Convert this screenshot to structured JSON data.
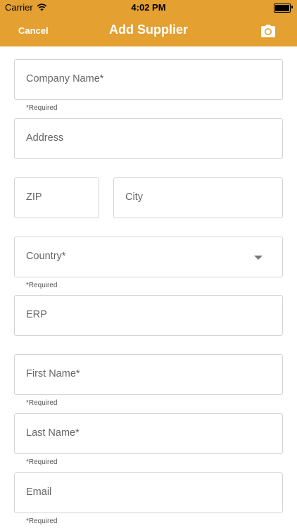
{
  "status": {
    "carrier": "Carrier",
    "time": "4:02 PM"
  },
  "nav": {
    "cancel_label": "Cancel",
    "title": "Add Supplier",
    "camera_icon": "camera-icon"
  },
  "colors": {
    "accent": "#e4a030",
    "field_border": "#d4d4d4",
    "placeholder": "#666666"
  },
  "form": {
    "company_name": {
      "placeholder": "Company Name*",
      "hint": "*Required"
    },
    "address": {
      "placeholder": "Address"
    },
    "zip": {
      "placeholder": "ZIP"
    },
    "city": {
      "placeholder": "City"
    },
    "country": {
      "placeholder": "Country*",
      "hint": "*Required"
    },
    "erp": {
      "placeholder": "ERP"
    },
    "first_name": {
      "placeholder": "First Name*",
      "hint": "*Required"
    },
    "last_name": {
      "placeholder": "Last Name*",
      "hint": "*Required"
    },
    "email": {
      "placeholder": "Email",
      "hint": "*Required"
    }
  }
}
